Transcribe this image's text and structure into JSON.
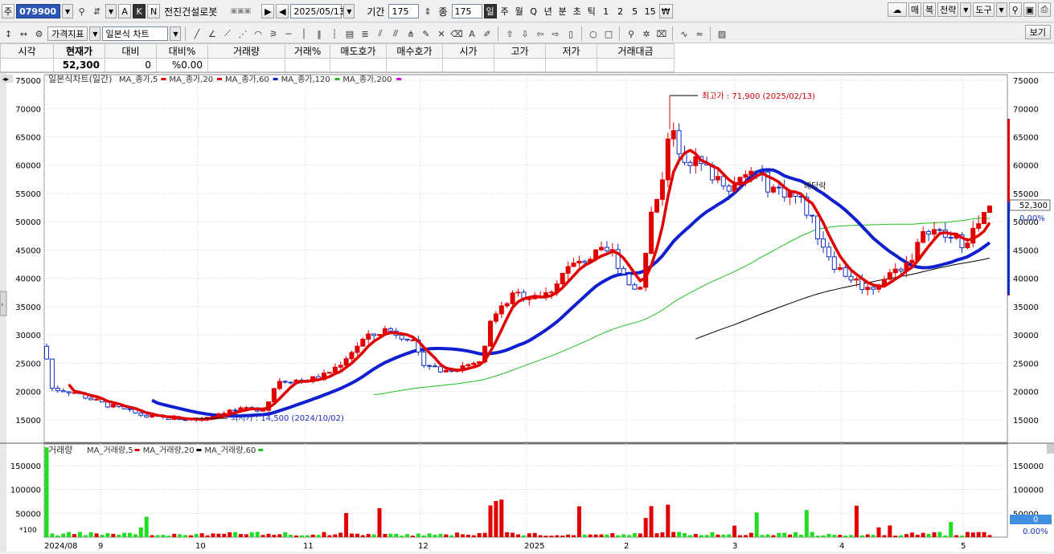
{
  "toolbar1": {
    "market_label": "주",
    "code": "079900",
    "btn_a": "A",
    "btn_k": "K",
    "btn_n": "N",
    "stock_name": "전진건설로봇",
    "date": "2025/05/13",
    "period_label": "기간",
    "period_value": "175",
    "count_label": "종",
    "count_value": "175",
    "intervals": [
      "일",
      "주",
      "월",
      "Q",
      "년",
      "분",
      "초",
      "틱",
      "1",
      "2",
      "5",
      "15"
    ],
    "right_buttons": [
      "매",
      "복",
      "전략",
      "도구"
    ]
  },
  "toolbar2": {
    "indicator_label": "가격지표",
    "chart_type": "일본식 차트",
    "view_button": "보기"
  },
  "quote": {
    "headers": [
      "시각",
      "현재가",
      "대비",
      "대비%",
      "거래량",
      "거래%",
      "매도호가",
      "매수호가",
      "시가",
      "고가",
      "저가",
      "거래대금"
    ],
    "values": [
      "",
      "52,300",
      "0",
      "%0.00",
      "",
      "",
      "",
      "",
      "",
      "",
      "",
      ""
    ]
  },
  "price_panel": {
    "legend_title": "일본식차트(일간)",
    "legend_items": [
      {
        "label": "MA_종가,5",
        "color": "#e00000"
      },
      {
        "label": "MA_종가,20",
        "color": "#e00000"
      },
      {
        "label": "MA_종가,60",
        "color": "#1020d0"
      },
      {
        "label": "MA_종가,120",
        "color": "#20c020"
      },
      {
        "label": "MA_종가,200",
        "color": "#e000e0"
      }
    ],
    "y_ticks": [
      75000,
      70000,
      65000,
      60000,
      55000,
      50000,
      45000,
      40000,
      35000,
      30000,
      25000,
      20000,
      15000
    ],
    "high_annotation": "최고가 : 71,900 (2025/02/13)",
    "low_annotation": "최저가 : 14,500 (2024/10/02)",
    "dividend_annotation": "배당락",
    "current_price": "52,300",
    "current_pct": "0.00%"
  },
  "volume_panel": {
    "legend_title": "거래량",
    "legend_items": [
      {
        "label": "MA_거래량,5",
        "color": "#e00000"
      },
      {
        "label": "MA_거래량,20",
        "color": "#000000"
      },
      {
        "label": "MA_거래량,60",
        "color": "#20c020"
      }
    ],
    "y_ticks": [
      150000,
      100000,
      50000
    ],
    "unit": "*100",
    "current_value": "0",
    "current_pct": "0.00%"
  },
  "x_axis": [
    "2024/08",
    "9",
    "10",
    "11",
    "12",
    "2025",
    "2",
    "3",
    "4",
    "5"
  ],
  "chart_data": {
    "type": "candlestick",
    "x_labels": [
      "2024/08",
      "9",
      "10",
      "11",
      "12",
      "2025",
      "2",
      "3",
      "4",
      "5"
    ],
    "ylim": [
      11000,
      76000
    ],
    "volume_ylim": [
      0,
      195000
    ],
    "key_points": [
      {
        "date": "2024/08",
        "close": 21000
      },
      {
        "date": "2024/09",
        "close": 17000
      },
      {
        "date": "2024/10/02",
        "low": 14500
      },
      {
        "date": "2024/11",
        "close": 21000
      },
      {
        "date": "2024/12",
        "close": 25000
      },
      {
        "date": "2025/01",
        "close": 37000
      },
      {
        "date": "2025/02/13",
        "high": 71900
      },
      {
        "date": "2025/03",
        "close": 57000
      },
      {
        "date": "2025/04",
        "close": 39000
      },
      {
        "date": "2025/05/13",
        "close": 52300
      }
    ]
  }
}
